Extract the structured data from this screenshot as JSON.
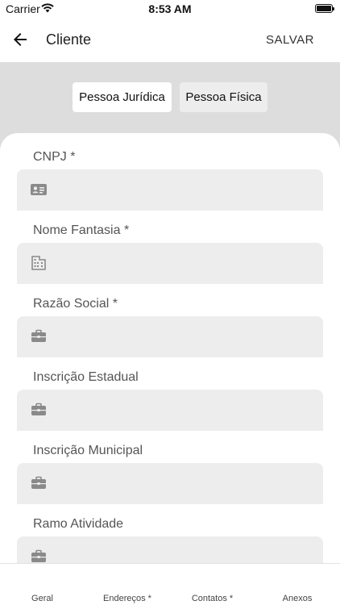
{
  "status_bar": {
    "carrier": "Carrier",
    "time": "8:53 AM"
  },
  "app_bar": {
    "title": "Cliente",
    "save_label": "SALVAR"
  },
  "person_type": {
    "options": [
      "Pessoa Jurídica",
      "Pessoa Física"
    ],
    "selected": "Pessoa Jurídica"
  },
  "form": {
    "fields": [
      {
        "label": "CNPJ *",
        "value": "",
        "icon": "id-card-icon"
      },
      {
        "label": "Nome Fantasia *",
        "value": "",
        "icon": "building-icon"
      },
      {
        "label": "Razão Social *",
        "value": "",
        "icon": "briefcase-icon"
      },
      {
        "label": "Inscrição Estadual",
        "value": "",
        "icon": "briefcase-icon"
      },
      {
        "label": "Inscrição Municipal",
        "value": "",
        "icon": "briefcase-icon"
      },
      {
        "label": "Ramo Atividade",
        "value": "",
        "icon": "briefcase-icon"
      }
    ]
  },
  "tabs": [
    "Geral",
    "Endereços *",
    "Contatos *",
    "Anexos"
  ],
  "colors": {
    "header_band": "#dddddd",
    "input_fill": "#ededed",
    "selected_toggle": "#ffffff"
  }
}
